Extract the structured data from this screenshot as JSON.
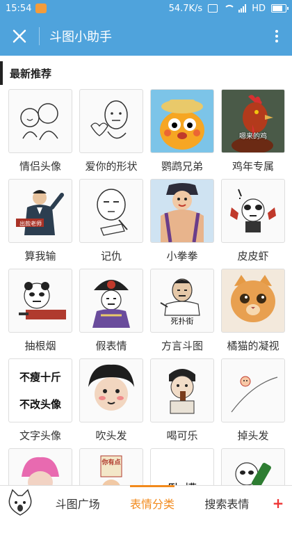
{
  "status_bar": {
    "time": "15:54",
    "speed": "54.7K/s",
    "network": "HD"
  },
  "app_bar": {
    "title": "斗图小助手"
  },
  "section": {
    "title": "最新推荐"
  },
  "items": [
    {
      "label": "情侣头像"
    },
    {
      "label": "爱你的形状"
    },
    {
      "label": "鹦鹉兄弟"
    },
    {
      "label": "鸡年专属"
    },
    {
      "label": "算我输"
    },
    {
      "label": "记仇"
    },
    {
      "label": "小拳拳"
    },
    {
      "label": "皮皮虾"
    },
    {
      "label": "抽根烟"
    },
    {
      "label": "假表情"
    },
    {
      "label": "方言斗图"
    },
    {
      "label": "橘猫的凝视"
    },
    {
      "label": "文字头像"
    },
    {
      "label": "吹头发"
    },
    {
      "label": "喝可乐"
    },
    {
      "label": "掉头发"
    },
    {
      "label": ""
    },
    {
      "label": ""
    },
    {
      "label": ""
    },
    {
      "label": ""
    }
  ],
  "thumb_texts": {
    "rooster": "嗯来的鸡",
    "sign": "出款老师",
    "place": "死扑街",
    "text_line1": "不瘦十斤",
    "text_line2": "不改头像",
    "partial1": "你有点",
    "partial2": "卧 槽"
  },
  "bottom_bar": {
    "tabs": [
      "斗图广场",
      "表情分类",
      "搜索表情"
    ],
    "active": "表情分类",
    "plus": "+"
  },
  "colors": {
    "primary": "#4fa3dc",
    "accent": "#f28a1c"
  }
}
